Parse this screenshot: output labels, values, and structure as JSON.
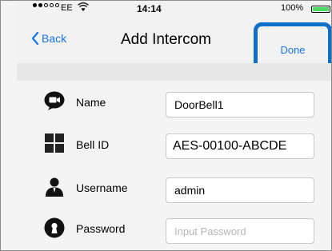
{
  "status_bar": {
    "carrier": "EE",
    "time": "14:14",
    "battery_text": "100%"
  },
  "nav": {
    "back_label": "Back",
    "title": "Add Intercom",
    "done_label": "Done"
  },
  "form": {
    "name": {
      "label": "Name",
      "value": "DoorBell1"
    },
    "bell_id": {
      "label": "Bell ID",
      "value": "AES-00100-ABCDE"
    },
    "username": {
      "label": "Username",
      "value": "admin"
    },
    "password": {
      "label": "Password",
      "placeholder": "Input Password"
    }
  },
  "colors": {
    "accent": "#1a73e8",
    "highlight": "#0d6fc8"
  }
}
